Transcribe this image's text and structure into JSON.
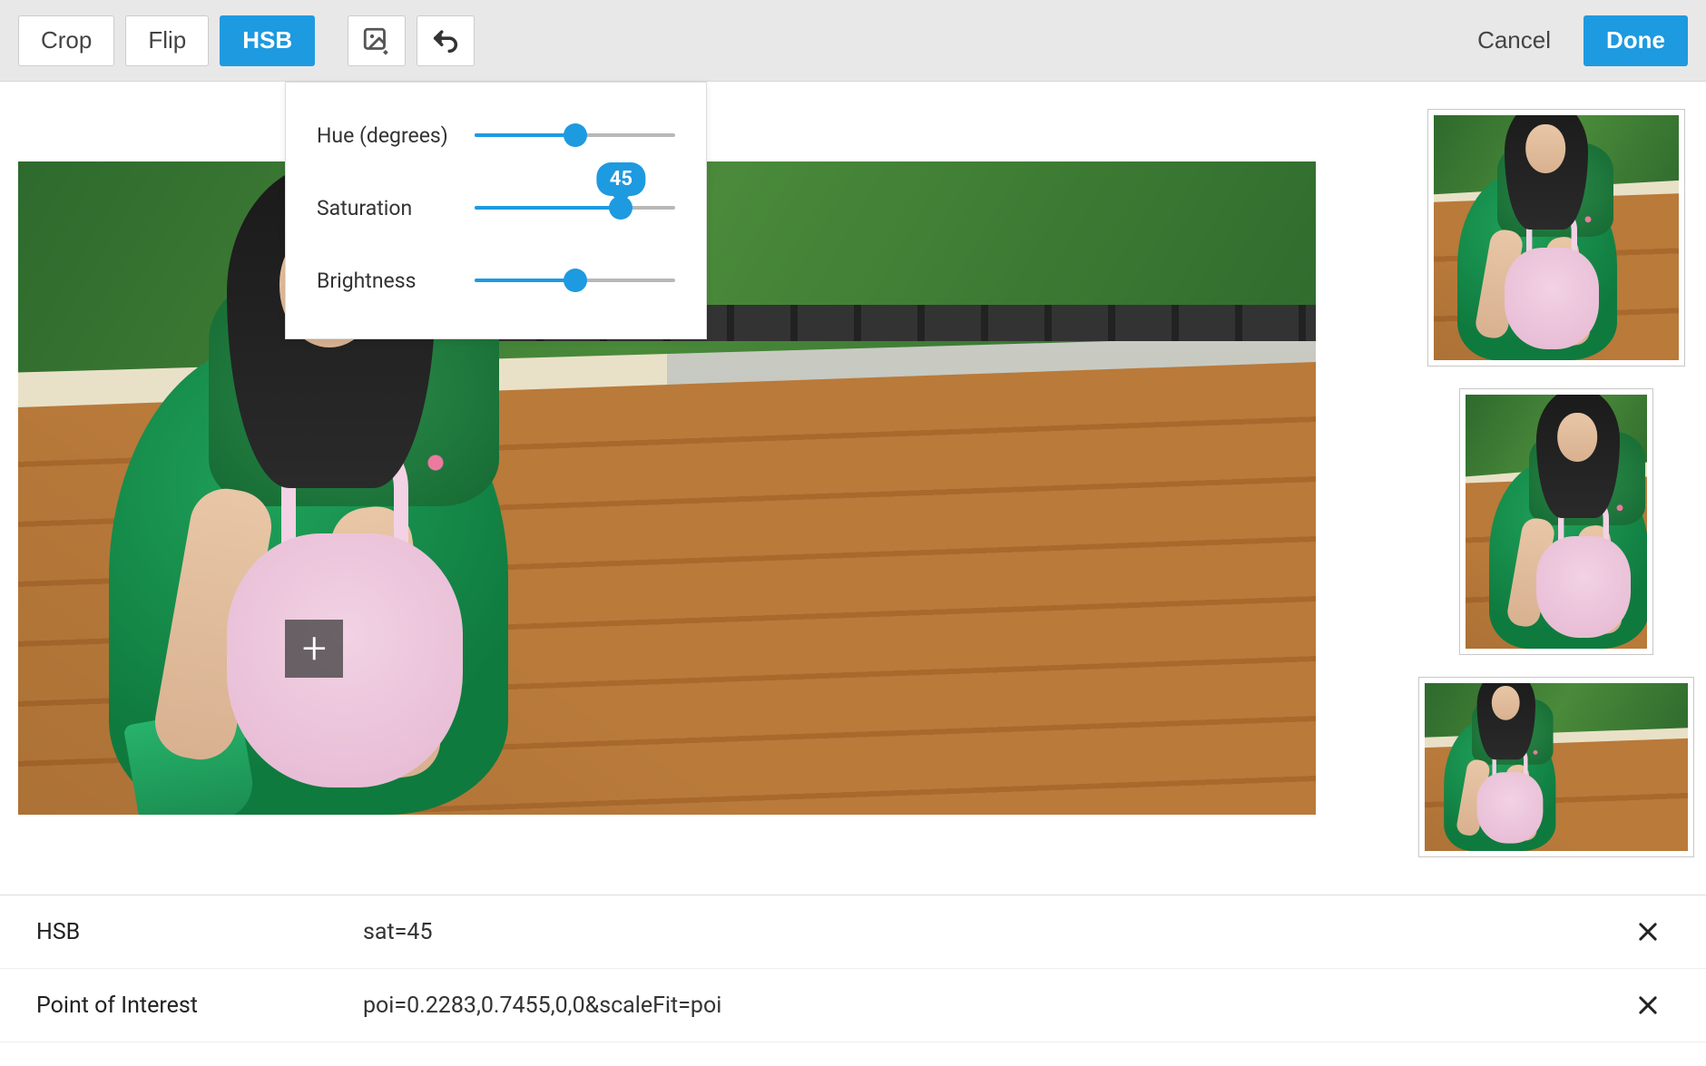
{
  "toolbar": {
    "crop_label": "Crop",
    "flip_label": "Flip",
    "hsb_label": "HSB",
    "cancel_label": "Cancel",
    "done_label": "Done"
  },
  "hsb_panel": {
    "hue_label": "Hue (degrees)",
    "saturation_label": "Saturation",
    "brightness_label": "Brightness",
    "hue_value": 0,
    "saturation_value": 45,
    "brightness_value": 0,
    "hue_percent": 50,
    "saturation_percent": 73,
    "brightness_percent": 50
  },
  "edits": [
    {
      "name": "HSB",
      "value": "sat=45"
    },
    {
      "name": "Point of Interest",
      "value": "poi=0.2283,0.7455,0,0&scaleFit=poi"
    }
  ],
  "colors": {
    "accent": "#1e9ae0"
  }
}
